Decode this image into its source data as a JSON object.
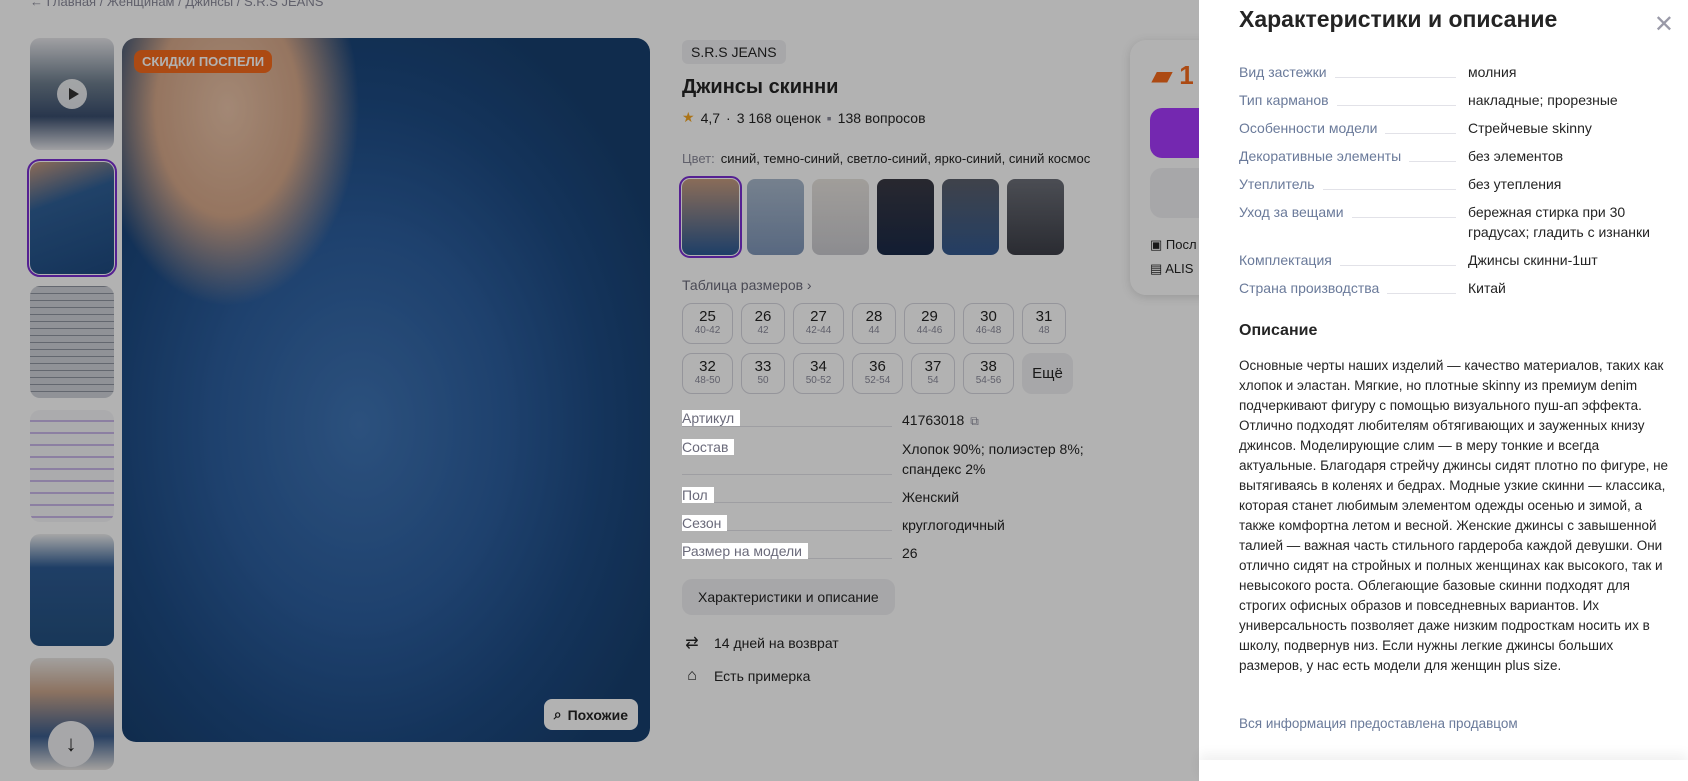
{
  "breadcrumbs": "←   Главная  /  Женщинам  /  Джинсы  /  S.R.S JEANS",
  "product": {
    "promo_badge": "СКИДКИ ПОСПЕЛИ",
    "similar_label": "Похожие",
    "brand": "S.R.S JEANS",
    "title": "Джинсы скинни",
    "rating": "4,7",
    "reviews": "3 168 оценок",
    "questions": "138 вопросов",
    "color_label": "Цвет:",
    "color_value": "синий, темно-синий, светло-синий, ярко-синий, синий космос",
    "size_table_link": "Таблица размеров ›",
    "sizes": [
      {
        "n": "25",
        "s": "40-42"
      },
      {
        "n": "26",
        "s": "42"
      },
      {
        "n": "27",
        "s": "42-44"
      },
      {
        "n": "28",
        "s": "44"
      },
      {
        "n": "29",
        "s": "44-46"
      },
      {
        "n": "30",
        "s": "46-48"
      },
      {
        "n": "31",
        "s": "48"
      },
      {
        "n": "32",
        "s": "48-50"
      },
      {
        "n": "33",
        "s": "50"
      },
      {
        "n": "34",
        "s": "50-52"
      },
      {
        "n": "36",
        "s": "52-54"
      },
      {
        "n": "37",
        "s": "54"
      },
      {
        "n": "38",
        "s": "54-56"
      }
    ],
    "more_label": "Ещё",
    "specs": [
      {
        "k": "Артикул",
        "v": "41763018"
      },
      {
        "k": "Состав",
        "v": "Хлопок 90%; полиэстер 8%; спандекс 2%"
      },
      {
        "k": "Пол",
        "v": "Женский"
      },
      {
        "k": "Сезон",
        "v": "круглогодичный"
      },
      {
        "k": "Размер на модели",
        "v": "26"
      }
    ],
    "char_button": "Характеристики и описание",
    "perks": [
      "14 дней на возврат",
      "Есть примерка"
    ]
  },
  "buy_card": {
    "price": "1",
    "line1": "Посл",
    "line2": "ALIS"
  },
  "drawer": {
    "title": "Характеристики и описание",
    "specs": [
      {
        "k": "Вид застежки",
        "v": "молния"
      },
      {
        "k": "Тип карманов",
        "v": "накладные; прорезные"
      },
      {
        "k": "Особенности модели",
        "v": "Стрейчевые skinny"
      },
      {
        "k": "Декоративные элементы",
        "v": "без элементов"
      },
      {
        "k": "Утеплитель",
        "v": "без утепления"
      },
      {
        "k": "Уход за вещами",
        "v": "бережная стирка при 30 градусах; гладить с изнанки"
      },
      {
        "k": "Комплектация",
        "v": "Джинсы скинни-1шт"
      },
      {
        "k": "Страна производства",
        "v": "Китай"
      }
    ],
    "desc_heading": "Описание",
    "description": "Основные черты наших изделий — качество материалов, таких как хлопок и эластан. Мягкие, но плотные skinny из премиум denim подчеркивают фигуру с помощью визуального пуш-ап эффекта. Отлично подходят любителям обтягивающих и зауженных книзу джинсов. Моделирующие слим — в меру тонкие и всегда актуальные. Благодаря стрейчу джинсы сидят плотно по фигуре, не вытягиваясь в коленях и бедрах. Модные узкие скинни — классика, которая станет любимым элементом одежды осенью и зимой, а также комфортна летом и весной. Женские джинсы с завышенной талией — важная часть стильного гардероба каждой девушки. Они отлично сидят на стройных и полных женщинах как высокого, так и невысокого роста. Облегающие базовые скинни подходят для строгих офисных образов и повседневных вариантов. Их универсальность позволяет даже низким подросткам носить их в школу, подвернув низ. Если нужны легкие джинсы больших размеров, у нас есть модели для женщин plus size.",
    "note": "Вся информация предоставлена продавцом"
  }
}
